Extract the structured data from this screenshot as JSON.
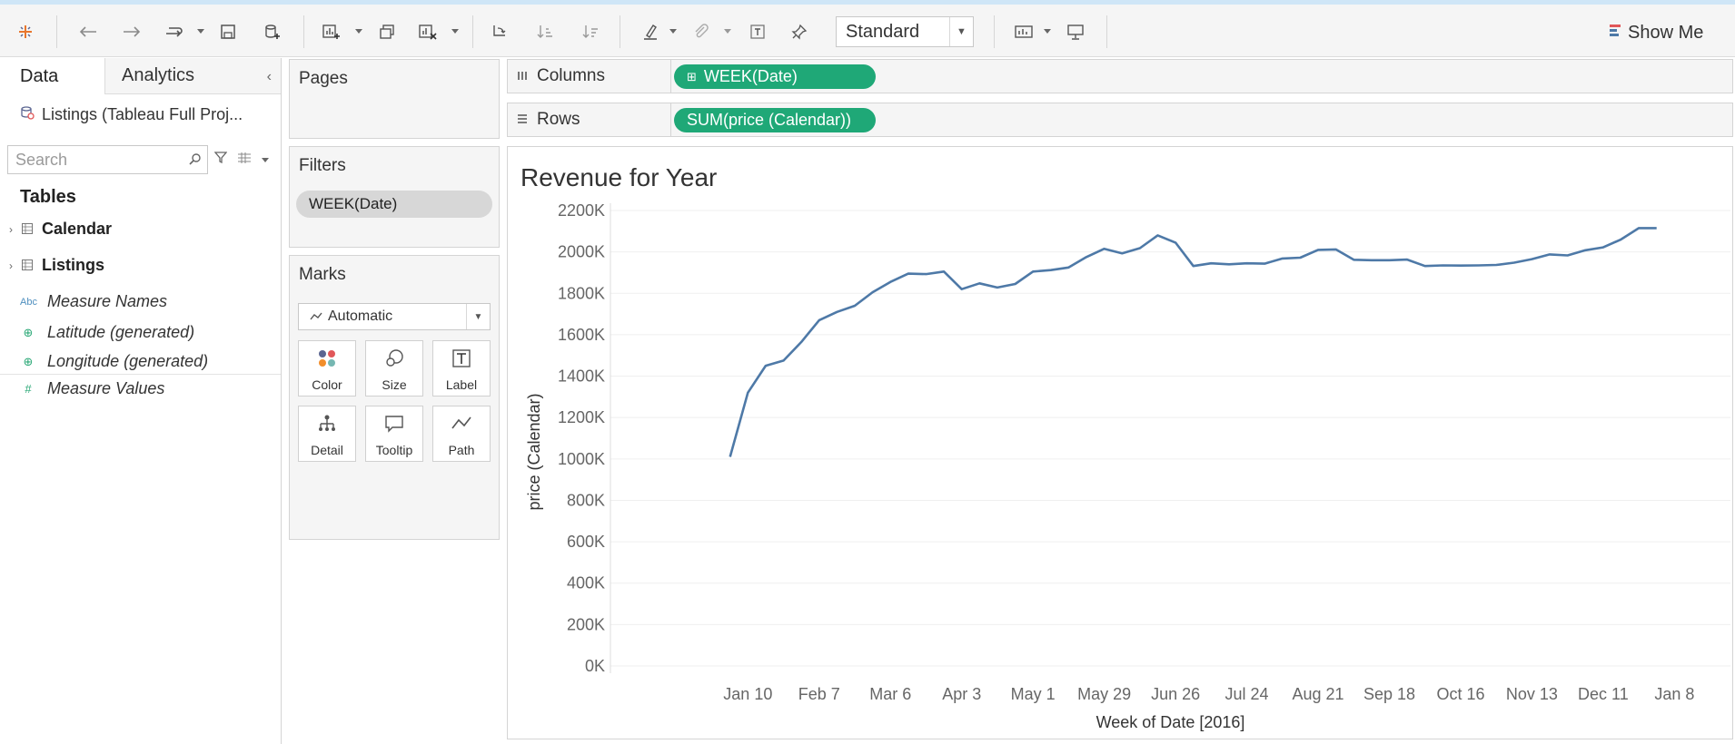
{
  "toolbar": {
    "view_size": "Standard",
    "show_me": "Show Me",
    "icons": [
      "tableau-logo-icon",
      "undo-icon",
      "redo-icon",
      "replay-icon",
      "save-icon",
      "new-datasource-icon",
      "new-worksheet-icon",
      "duplicate-icon",
      "clear-sheet-icon",
      "swap-icon",
      "sort-ascending-icon",
      "sort-descending-icon",
      "highlight-icon",
      "group-icon",
      "text-label-icon",
      "pin-icon",
      "fit-icon",
      "presentation-icon"
    ]
  },
  "data_pane": {
    "tab_data": "Data",
    "tab_analytics": "Analytics",
    "datasource": "Listings (Tableau Full Proj...",
    "search_placeholder": "Search",
    "tables_heading": "Tables",
    "tables": [
      {
        "name": "Calendar"
      },
      {
        "name": "Listings"
      }
    ],
    "fields": [
      {
        "name": "Measure Names",
        "icon": "Abc"
      },
      {
        "name": "Latitude (generated)",
        "icon": "globe-icon"
      },
      {
        "name": "Longitude (generated)",
        "icon": "globe-icon"
      },
      {
        "name": "Measure Values",
        "icon": "#"
      }
    ]
  },
  "cards": {
    "pages_title": "Pages",
    "filters_title": "Filters",
    "filter_pill": "WEEK(Date)",
    "marks_title": "Marks",
    "mark_type": "Automatic",
    "mark_buttons": [
      "Color",
      "Size",
      "Label",
      "Detail",
      "Tooltip",
      "Path"
    ]
  },
  "shelves": {
    "columns_label": "Columns",
    "columns_pill": "WEEK(Date)",
    "rows_label": "Rows",
    "rows_pill": "SUM(price (Calendar))"
  },
  "viz": {
    "title": "Revenue for Year"
  },
  "chart_data": {
    "type": "line",
    "title": "Revenue for Year",
    "xlabel": "Week of Date [2016]",
    "ylabel": "price (Calendar)",
    "x_ticks": [
      "Jan 10",
      "Feb 7",
      "Mar 6",
      "Apr 3",
      "May 1",
      "May 29",
      "Jun 26",
      "Jul 24",
      "Aug 21",
      "Sep 18",
      "Oct 16",
      "Nov 13",
      "Dec 11",
      "Jan 8"
    ],
    "y_ticks": [
      "2200K",
      "2000K",
      "1800K",
      "1600K",
      "1400K",
      "1200K",
      "1000K",
      "800K",
      "600K",
      "400K",
      "200K",
      "0K"
    ],
    "ylim": [
      0,
      2200000
    ],
    "grid": true,
    "color": "#4e79a7",
    "series": [
      {
        "x": [
          "2016-01-03",
          "2016-01-10",
          "2016-01-17",
          "2016-01-24",
          "2016-01-31",
          "2016-02-07",
          "2016-02-14",
          "2016-02-21",
          "2016-02-28",
          "2016-03-06",
          "2016-03-13",
          "2016-03-20",
          "2016-03-27",
          "2016-04-03",
          "2016-04-10",
          "2016-04-17",
          "2016-04-24",
          "2016-05-01",
          "2016-05-08",
          "2016-05-15",
          "2016-05-22",
          "2016-05-29",
          "2016-06-05",
          "2016-06-12",
          "2016-06-19",
          "2016-06-26",
          "2016-07-03",
          "2016-07-10",
          "2016-07-17",
          "2016-07-24",
          "2016-07-31",
          "2016-08-07",
          "2016-08-14",
          "2016-08-21",
          "2016-08-28",
          "2016-09-04",
          "2016-09-11",
          "2016-09-18",
          "2016-09-25",
          "2016-10-02",
          "2016-10-09",
          "2016-10-16",
          "2016-10-23",
          "2016-10-30",
          "2016-11-06",
          "2016-11-13",
          "2016-11-20",
          "2016-11-27",
          "2016-12-04",
          "2016-12-11",
          "2016-12-18",
          "2016-12-25",
          "2017-01-01"
        ],
        "values": [
          1010000,
          1320000,
          1450000,
          1475000,
          1565000,
          1670000,
          1710000,
          1740000,
          1805000,
          1855000,
          1895000,
          1893000,
          1905000,
          1820000,
          1848000,
          1828000,
          1845000,
          1905000,
          1912000,
          1925000,
          1975000,
          2015000,
          1993000,
          2018000,
          2080000,
          2045000,
          1932000,
          1945000,
          1940000,
          1945000,
          1943000,
          1968000,
          1972000,
          2010000,
          2012000,
          1962000,
          1960000,
          1960000,
          1963000,
          1932000,
          1935000,
          1934000,
          1935000,
          1937000,
          1948000,
          1965000,
          1988000,
          1983000,
          2008000,
          2022000,
          2060000,
          2115000,
          2115000
        ]
      }
    ]
  }
}
